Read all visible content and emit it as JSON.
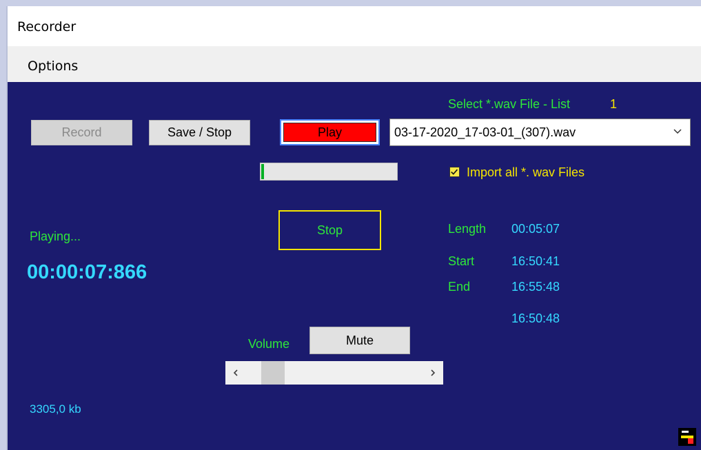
{
  "window": {
    "title": "Recorder"
  },
  "menu": {
    "options_label": "Options"
  },
  "buttons": {
    "record": "Record",
    "save_stop": "Save / Stop",
    "play": "Play",
    "stop": "Stop",
    "mute": "Mute"
  },
  "file_select": {
    "label": "Select *.wav File - List",
    "count": "1",
    "selected": "03-17-2020_17-03-01_(307).wav"
  },
  "import_all": {
    "label": "Import all *. wav Files",
    "checked": true
  },
  "playback": {
    "status": "Playing...",
    "time": "00:00:07:866",
    "progress_fraction": 0.02
  },
  "info": {
    "length_label": "Length",
    "length_value": "00:05:07",
    "start_label": "Start",
    "start_value": "16:50:41",
    "end_label": "End",
    "end_value": "16:55:48",
    "current_value": "16:50:48"
  },
  "volume": {
    "label": "Volume",
    "level_fraction": 0.1
  },
  "file_size": "3305,0 kb",
  "colors": {
    "background": "#1b1b6e",
    "accent_green": "#2ee83a",
    "accent_cyan": "#35d9ff",
    "accent_yellow": "#f5e500",
    "play_red": "#ff0000"
  },
  "icons": {
    "combo_arrow": "chevron-down-icon",
    "scroll_left": "chevron-left-icon",
    "scroll_right": "chevron-right-icon",
    "corner": "app-logo-icon"
  }
}
